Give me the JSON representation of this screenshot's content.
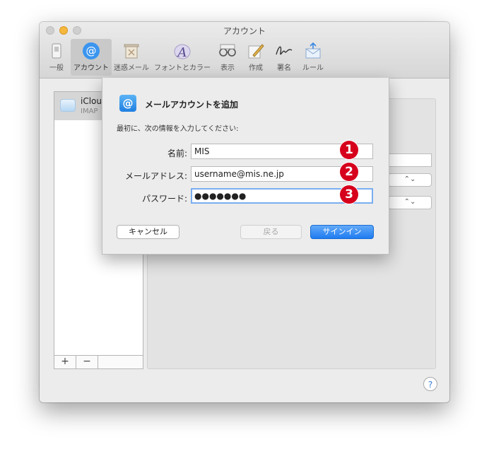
{
  "window": {
    "title": "アカウント",
    "toolbar": [
      {
        "label": "一般",
        "icon": "switch-icon"
      },
      {
        "label": "アカウント",
        "icon": "at-icon",
        "active": true
      },
      {
        "label": "迷惑メール",
        "icon": "trash-icon"
      },
      {
        "label": "フォントとカラー",
        "icon": "font-icon"
      },
      {
        "label": "表示",
        "icon": "glasses-icon"
      },
      {
        "label": "作成",
        "icon": "pencil-icon"
      },
      {
        "label": "署名",
        "icon": "signature-icon"
      },
      {
        "label": "ルール",
        "icon": "rules-icon"
      }
    ]
  },
  "accounts": {
    "items": [
      {
        "name": "iClou",
        "type": "IMAP"
      }
    ],
    "add_label": "+",
    "remove_label": "−"
  },
  "help_label": "?",
  "sheet": {
    "icon_glyph": "@",
    "title": "メールアカウントを追加",
    "subtitle": "最初に、次の情報を入力してください:",
    "fields": [
      {
        "label": "名前:",
        "value": "MIS",
        "badge": "1"
      },
      {
        "label": "メールアドレス:",
        "value": "username@mis.ne.jp",
        "badge": "2"
      },
      {
        "label": "パスワード:",
        "value": "●●●●●●●",
        "badge": "3"
      }
    ],
    "cancel_label": "キャンセル",
    "back_label": "戻る",
    "signin_label": "サインイン"
  },
  "colors": {
    "accent": "#1f7cf0",
    "badge": "#d6001c"
  }
}
